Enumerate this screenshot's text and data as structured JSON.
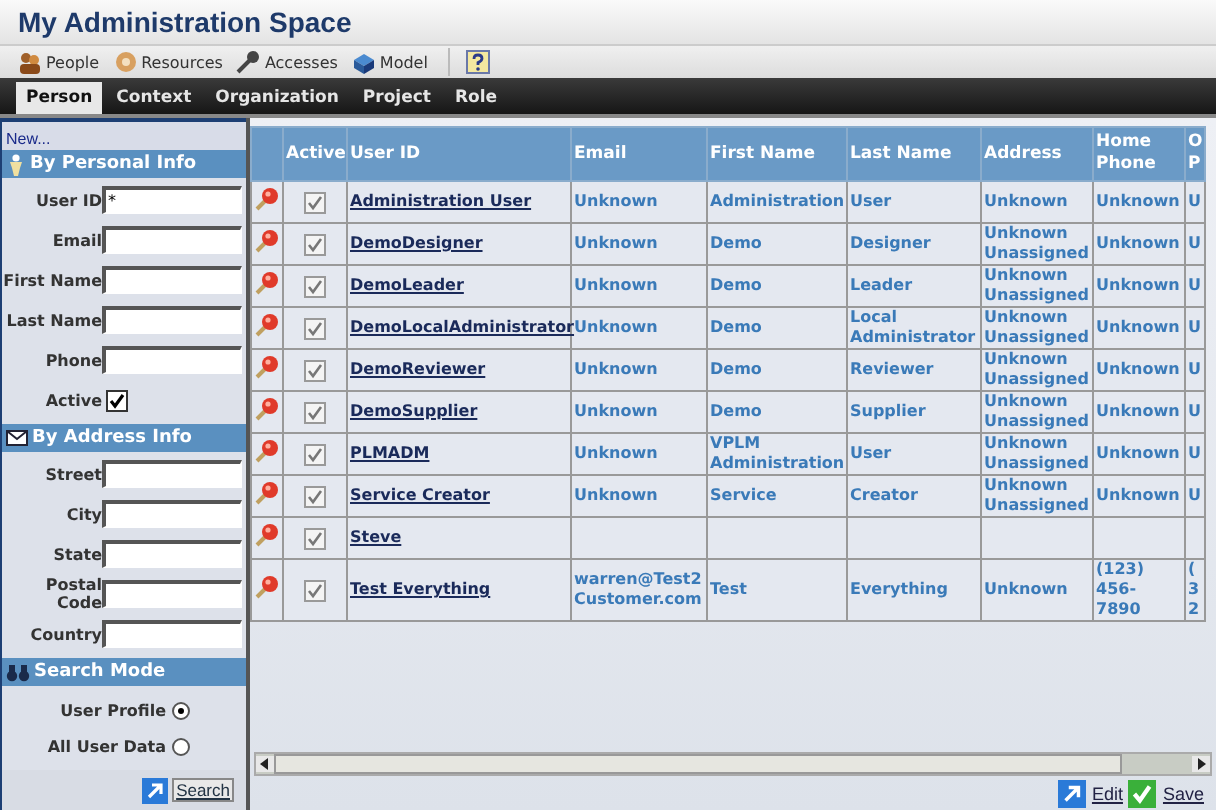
{
  "title": "My Administration Space",
  "toolbar": [
    {
      "kind": "people",
      "label": "People"
    },
    {
      "kind": "resources",
      "label": "Resources"
    },
    {
      "kind": "accesses",
      "label": "Accesses"
    },
    {
      "kind": "model",
      "label": "Model"
    }
  ],
  "tabs": [
    {
      "label": "Person",
      "selected": true
    },
    {
      "label": "Context",
      "selected": false
    },
    {
      "label": "Organization",
      "selected": false
    },
    {
      "label": "Project",
      "selected": false
    },
    {
      "label": "Role",
      "selected": false
    }
  ],
  "sidebar": {
    "new_link": "New...",
    "sections": [
      {
        "kind": "person",
        "title": "By Personal Info",
        "fields": [
          {
            "kind": "text",
            "label": "User ID",
            "value": "*"
          },
          {
            "kind": "text",
            "label": "Email"
          },
          {
            "kind": "text",
            "label": "First Name"
          },
          {
            "kind": "text",
            "label": "Last Name"
          },
          {
            "kind": "text",
            "label": "Phone"
          },
          {
            "kind": "checkbox",
            "label": "Active",
            "checked": true
          }
        ]
      },
      {
        "kind": "envelope",
        "title": "By Address Info",
        "fields": [
          {
            "kind": "text",
            "label": "Street"
          },
          {
            "kind": "text",
            "label": "City"
          },
          {
            "kind": "text",
            "label": "State"
          },
          {
            "kind": "text",
            "label": "Postal Code"
          },
          {
            "kind": "text",
            "label": "Country"
          }
        ]
      }
    ],
    "search_mode": {
      "title": "Search Mode",
      "options": [
        {
          "label": "User Profile",
          "selected": true
        },
        {
          "label": "All User Data",
          "selected": false
        }
      ]
    },
    "search_button": "Search"
  },
  "table": {
    "columns": [
      "Active",
      "User ID",
      "Email",
      "First Name",
      "Last Name",
      "Address",
      "Home Phone",
      "O P"
    ],
    "rows": [
      {
        "active": true,
        "user_id": "Administration User",
        "email": "Unknown",
        "first_name": "Administration",
        "last_name": "User",
        "address": "Unknown",
        "home_phone": "Unknown",
        "column_8": "U"
      },
      {
        "active": true,
        "user_id": "DemoDesigner",
        "email": "Unknown",
        "first_name": "Demo",
        "last_name": "Designer",
        "address": "Unknown Unassigned",
        "home_phone": "Unknown",
        "column_8": "U"
      },
      {
        "active": true,
        "user_id": "DemoLeader",
        "email": "Unknown",
        "first_name": "Demo",
        "last_name": "Leader",
        "address": "Unknown Unassigned",
        "home_phone": "Unknown",
        "column_8": "U"
      },
      {
        "active": true,
        "user_id": "DemoLocalAdministrator",
        "email": "Unknown",
        "first_name": "Demo",
        "last_name": "Local Administrator",
        "address": "Unknown Unassigned",
        "home_phone": "Unknown",
        "column_8": "U"
      },
      {
        "active": true,
        "user_id": "DemoReviewer",
        "email": "Unknown",
        "first_name": "Demo",
        "last_name": "Reviewer",
        "address": "Unknown Unassigned",
        "home_phone": "Unknown",
        "column_8": "U"
      },
      {
        "active": true,
        "user_id": "DemoSupplier",
        "email": "Unknown",
        "first_name": "Demo",
        "last_name": "Supplier",
        "address": "Unknown Unassigned",
        "home_phone": "Unknown",
        "column_8": "U"
      },
      {
        "active": true,
        "user_id": "PLMADM",
        "email": "Unknown",
        "first_name": "VPLM Administration",
        "last_name": "User",
        "address": "Unknown Unassigned",
        "home_phone": "Unknown",
        "column_8": "U"
      },
      {
        "active": true,
        "user_id": "Service Creator",
        "email": "Unknown",
        "first_name": "Service",
        "last_name": "Creator",
        "address": "Unknown Unassigned",
        "home_phone": "Unknown",
        "column_8": "U"
      },
      {
        "active": true,
        "user_id": "Steve"
      },
      {
        "active": true,
        "user_id": "Test Everything",
        "email": "warren@Test2 Customer.com",
        "first_name": "Test",
        "last_name": "Everything",
        "address": "Unknown",
        "home_phone": "(123) 456- 7890",
        "column_8": "( 3 2"
      }
    ]
  },
  "footer": {
    "edit": "Edit",
    "save": "Save"
  }
}
